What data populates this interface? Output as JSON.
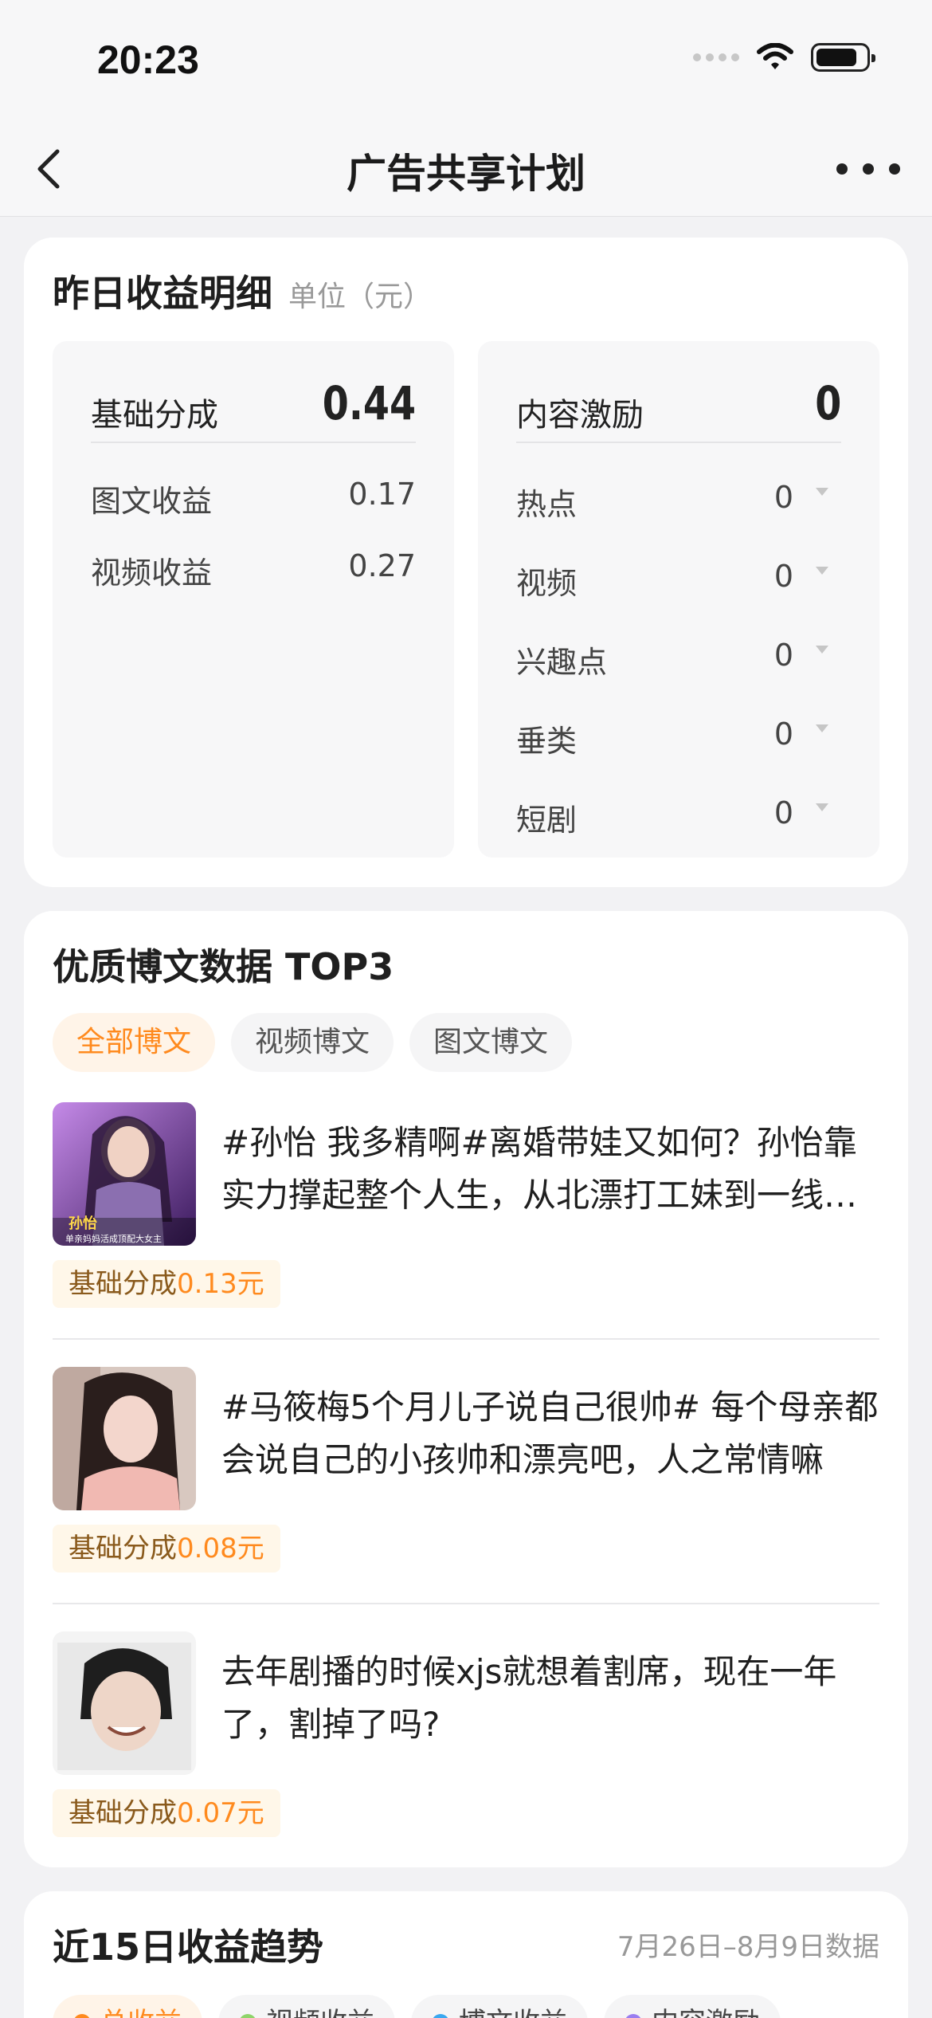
{
  "status": {
    "time": "20:23"
  },
  "nav": {
    "title": "广告共享计划"
  },
  "yesterday": {
    "title": "昨日收益明细",
    "unit": "单位（元）",
    "base": {
      "label": "基础分成",
      "value": "0.44",
      "rows": [
        {
          "label": "图文收益",
          "value": "0.17"
        },
        {
          "label": "视频收益",
          "value": "0.27"
        }
      ]
    },
    "incentive": {
      "label": "内容激励",
      "value": "0",
      "rows": [
        {
          "label": "热点",
          "value": "0"
        },
        {
          "label": "视频",
          "value": "0"
        },
        {
          "label": "兴趣点",
          "value": "0"
        },
        {
          "label": "垂类",
          "value": "0"
        },
        {
          "label": "短剧",
          "value": "0"
        }
      ]
    }
  },
  "top3": {
    "title": "优质博文数据 TOP3",
    "tabs": [
      "全部博文",
      "视频博文",
      "图文博文"
    ],
    "posts": [
      {
        "text": "#孙怡 我多精啊#离婚带娃又如何？孙怡靠实力撑起整个人生，从北漂打工妹到一线女演员的逆袭之路",
        "badge_label": "基础分成",
        "badge_amount": "0.13元",
        "thumb_caption": "孙怡",
        "thumb_sub": "单亲妈妈活成顶配大女主"
      },
      {
        "text": "#马筱梅5个月儿子说自己很帅# 每个母亲都会说自己的小孩帅和漂亮吧，人之常情嘛",
        "badge_label": "基础分成",
        "badge_amount": "0.08元"
      },
      {
        "text": "去年剧播的时候xjs就想着割席，现在一年了，割掉了吗?",
        "badge_label": "基础分成",
        "badge_amount": "0.07元"
      }
    ]
  },
  "trend": {
    "title": "近15日收益趋势",
    "range": "7月26日–8月9日数据",
    "legend": [
      {
        "label": "总收益",
        "color": "#ff8a1e"
      },
      {
        "label": "视频收益",
        "color": "#8fd46a"
      },
      {
        "label": "博文收益",
        "color": "#3aa8f0"
      },
      {
        "label": "内容激励",
        "color": "#9a7ef0"
      }
    ]
  }
}
